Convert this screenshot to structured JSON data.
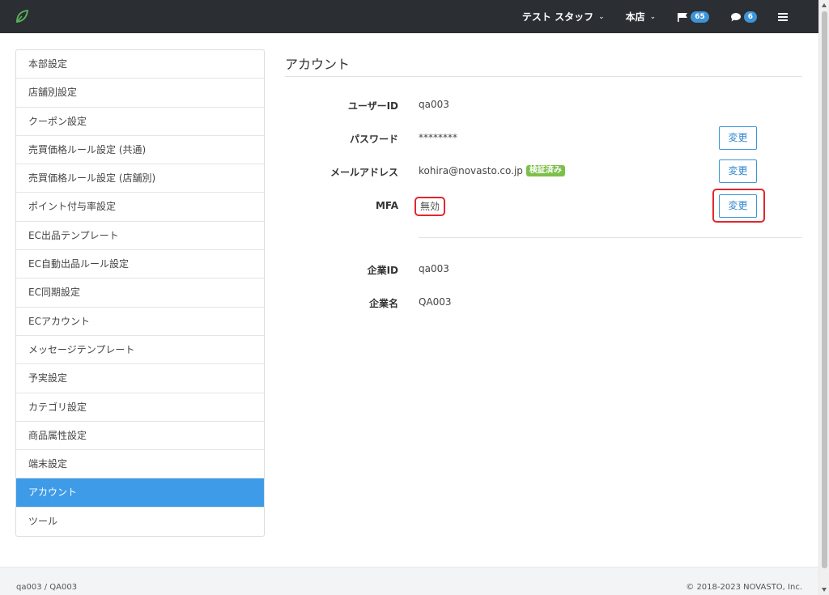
{
  "navbar": {
    "logo_icon": "leaf-icon",
    "user_label": "テスト スタッフ",
    "store_label": "本店",
    "flag_count": "65",
    "message_count": "6",
    "accent": "#3d95d8"
  },
  "sidebar": {
    "items": [
      {
        "label": "本部設定"
      },
      {
        "label": "店舗別設定"
      },
      {
        "label": "クーポン設定"
      },
      {
        "label": "売買価格ルール設定 (共通)"
      },
      {
        "label": "売買価格ルール設定 (店舗別)"
      },
      {
        "label": "ポイント付与率設定"
      },
      {
        "label": "EC出品テンプレート"
      },
      {
        "label": "EC自動出品ルール設定"
      },
      {
        "label": "EC同期設定"
      },
      {
        "label": "ECアカウント"
      },
      {
        "label": "メッセージテンプレート"
      },
      {
        "label": "予実設定"
      },
      {
        "label": "カテゴリ設定"
      },
      {
        "label": "商品属性設定"
      },
      {
        "label": "端末設定"
      },
      {
        "label": "アカウント"
      },
      {
        "label": "ツール"
      }
    ],
    "active_index": 15
  },
  "main": {
    "title": "アカウント",
    "user_id_label": "ユーザーID",
    "user_id_value": "qa003",
    "password_label": "パスワード",
    "password_value": "********",
    "email_label": "メールアドレス",
    "email_value": "kohira@novasto.co.jp",
    "email_verified_badge": "検証済み",
    "mfa_label": "MFA",
    "mfa_value": "無効",
    "change_label": "変更",
    "company_id_label": "企業ID",
    "company_id_value": "qa003",
    "company_name_label": "企業名",
    "company_name_value": "QA003"
  },
  "footer": {
    "left": "qa003 / QA003",
    "right": "© 2018-2023 NOVASTO, Inc."
  }
}
